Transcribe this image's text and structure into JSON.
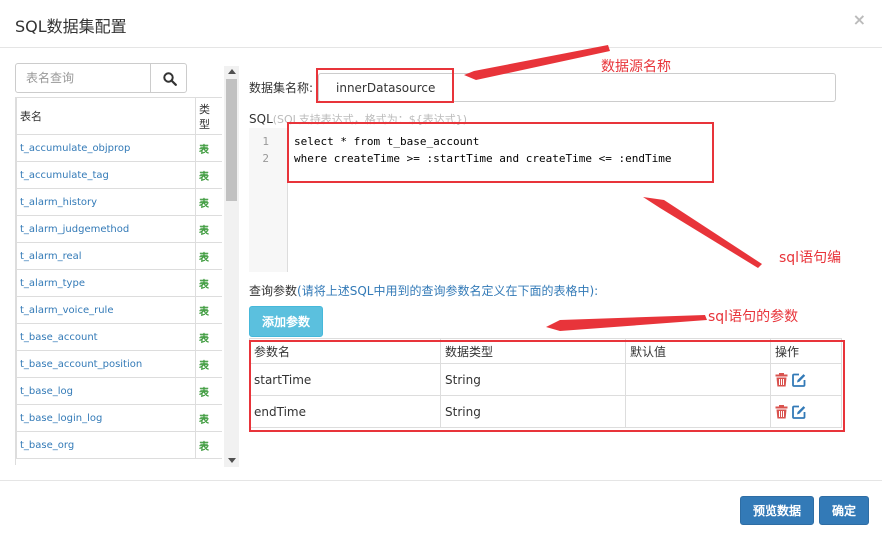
{
  "dialog": {
    "title": "SQL数据集配置",
    "close_symbol": "×"
  },
  "left_panel": {
    "search_placeholder": "表名查询",
    "search_icon": "search-icon",
    "table_headers": {
      "name": "表名",
      "type": "类型"
    },
    "tables": [
      {
        "name": "t_accumulate_objprop",
        "type": "表"
      },
      {
        "name": "t_accumulate_tag",
        "type": "表"
      },
      {
        "name": "t_alarm_history",
        "type": "表"
      },
      {
        "name": "t_alarm_judgemethod",
        "type": "表"
      },
      {
        "name": "t_alarm_real",
        "type": "表"
      },
      {
        "name": "t_alarm_type",
        "type": "表"
      },
      {
        "name": "t_alarm_voice_rule",
        "type": "表"
      },
      {
        "name": "t_base_account",
        "type": "表"
      },
      {
        "name": "t_base_account_position",
        "type": "表"
      },
      {
        "name": "t_base_log",
        "type": "表"
      },
      {
        "name": "t_base_login_log",
        "type": "表"
      },
      {
        "name": "t_base_org",
        "type": "表"
      }
    ]
  },
  "datasource": {
    "label": "数据集名称:",
    "value": "innerDatasource"
  },
  "sql": {
    "label": "SQL",
    "hint": "(SQL支持表达式，格式为：${表达式})",
    "line_numbers": [
      "1",
      "2"
    ],
    "lines": [
      "select * from t_base_account",
      "where createTime >= :startTime and createTime <= :endTime"
    ]
  },
  "params": {
    "label": "查询参数",
    "hint": "(请将上述SQL中用到的查询参数名定义在下面的表格中):",
    "add_button": "添加参数",
    "headers": [
      "参数名",
      "数据类型",
      "默认值",
      "操作"
    ],
    "rows": [
      {
        "name": "startTime",
        "type": "String",
        "default": ""
      },
      {
        "name": "endTime",
        "type": "String",
        "default": ""
      }
    ],
    "action_icons": [
      "trash-icon",
      "edit-icon"
    ]
  },
  "footer": {
    "preview_button": "预览数据",
    "ok_button": "确定"
  },
  "annotations": {
    "datasource_name": "数据源名称",
    "sql_editor": "sql语句编",
    "sql_params": "sql语句的参数",
    "color": "#e8343a"
  }
}
